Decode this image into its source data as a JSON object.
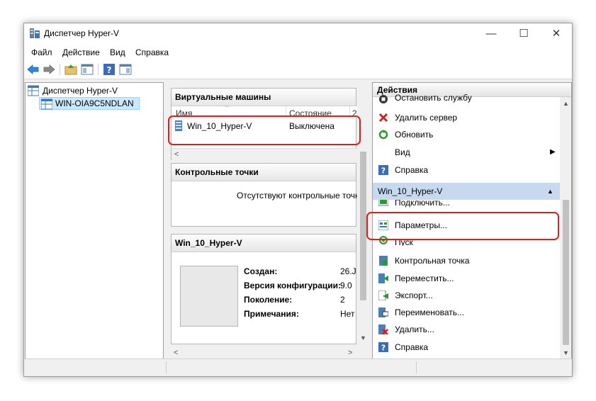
{
  "window": {
    "title": "Диспетчер Hyper-V",
    "minimize": "—",
    "maximize": "☐",
    "close": "✕"
  },
  "menu": [
    "Файл",
    "Действие",
    "Вид",
    "Справка"
  ],
  "toolbar_icons": [
    "back-arrow-icon",
    "forward-arrow-icon",
    "folder-up-icon",
    "show-tree-icon",
    "help-icon",
    "show-action-pane-icon"
  ],
  "tree": {
    "root": "Диспетчер Hyper-V",
    "server": "WIN-OIA9C5NDLAN"
  },
  "vm_section": {
    "title": "Виртуальные машины",
    "col_name": "Имя",
    "col_state": "Состояние",
    "col_extra": "2",
    "rows": [
      {
        "name": "Win_10_Hyper-V",
        "state": "Выключена"
      }
    ]
  },
  "checkpoints_section": {
    "title": "Контрольные точки",
    "empty_text": "Отсутствуют контрольные точки"
  },
  "details_section": {
    "title": "Win_10_Hyper-V",
    "items": [
      {
        "key": "Создан:",
        "value": "26.J"
      },
      {
        "key": "Версия конфигурации:",
        "value": "9.0"
      },
      {
        "key": "Поколение:",
        "value": "2"
      },
      {
        "key": "Примечания:",
        "value": "Нет"
      }
    ]
  },
  "actions": {
    "title": "Действия",
    "server_actions": [
      {
        "label": "Остановить службу",
        "icon": "stop-service-icon"
      },
      {
        "label": "Удалить сервер",
        "icon": "delete-x-icon"
      },
      {
        "label": "Обновить",
        "icon": "refresh-icon"
      },
      {
        "label": "Вид",
        "icon": "",
        "submenu": "▶"
      },
      {
        "label": "Справка",
        "icon": "help-icon"
      }
    ],
    "vm_group": "Win_10_Hyper-V",
    "vm_group_toggle": "▲",
    "vm_actions": [
      {
        "label": "Подключить...",
        "icon": "connect-icon"
      },
      {
        "label": "Параметры...",
        "icon": "settings-icon"
      },
      {
        "label": "Пуск",
        "icon": "power-icon"
      },
      {
        "label": "Контрольная точка",
        "icon": "checkpoint-icon"
      },
      {
        "label": "Переместить...",
        "icon": "move-icon"
      },
      {
        "label": "Экспорт...",
        "icon": "export-icon"
      },
      {
        "label": "Переименовать...",
        "icon": "rename-icon"
      },
      {
        "label": "Удалить...",
        "icon": "delete-vm-icon"
      },
      {
        "label": "Справка",
        "icon": "help-icon"
      }
    ]
  },
  "colors": {
    "highlight": "#e21c1c",
    "selection": "#cce8ff",
    "group_header": "#c6d9ef"
  }
}
